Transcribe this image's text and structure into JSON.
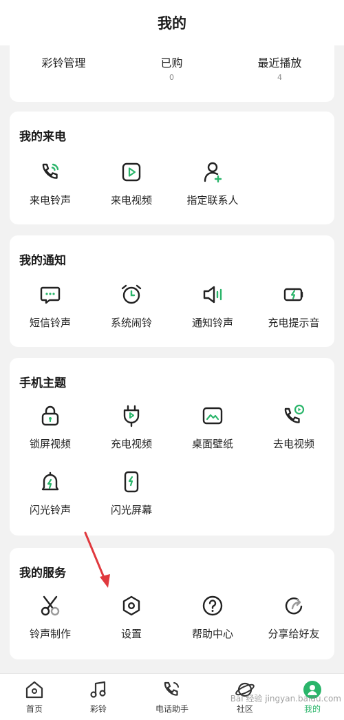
{
  "header": {
    "title": "我的"
  },
  "stats": [
    {
      "label": "彩铃管理",
      "value": ""
    },
    {
      "label": "已购",
      "value": "0"
    },
    {
      "label": "最近播放",
      "value": "4"
    }
  ],
  "sections": {
    "incoming": {
      "title": "我的来电",
      "items": [
        "来电铃声",
        "来电视频",
        "指定联系人"
      ]
    },
    "notify": {
      "title": "我的通知",
      "items": [
        "短信铃声",
        "系统闹铃",
        "通知铃声",
        "充电提示音"
      ]
    },
    "theme": {
      "title": "手机主题",
      "items": [
        "锁屏视频",
        "充电视频",
        "桌面壁纸",
        "去电视频",
        "闪光铃声",
        "闪光屏幕"
      ]
    },
    "service": {
      "title": "我的服务",
      "items": [
        "铃声制作",
        "设置",
        "帮助中心",
        "分享给好友"
      ]
    }
  },
  "tabbar": {
    "items": [
      "首页",
      "彩铃",
      "电话助手",
      "社区",
      "我的"
    ],
    "active": "我的"
  },
  "watermark": "Bai 经验 jingyan.baidu.com",
  "colors": {
    "accent": "#2ab56a",
    "icon_stroke": "#222222",
    "background": "#f2f2f2",
    "annotation_arrow": "#e0393e"
  }
}
